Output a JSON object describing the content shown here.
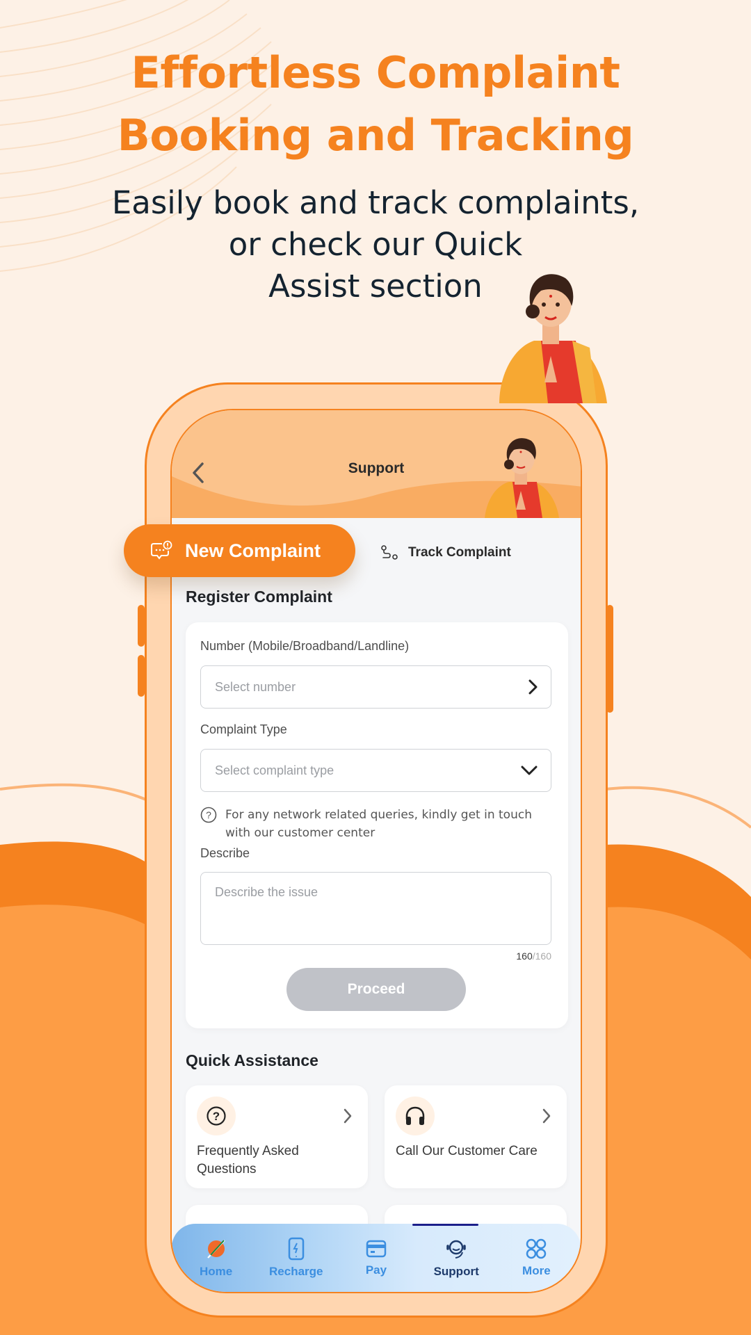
{
  "hero": {
    "title_line1": "Effortless Complaint",
    "title_line2": "Booking and Tracking",
    "subtitle_line1": "Easily book and track complaints,",
    "subtitle_line2": "or check our Quick",
    "subtitle_line3": "Assist section"
  },
  "colors": {
    "brand_orange": "#f5821f",
    "background": "#fdf1e6",
    "nav_active": "#1d3a6b",
    "nav_inactive": "#3b8ee0"
  },
  "header": {
    "title": "Support",
    "back_icon": "chevron-left-icon"
  },
  "tabs": {
    "new_complaint": {
      "label": "New Complaint",
      "icon": "chat-alert-icon",
      "active": true
    },
    "track_complaint": {
      "label": "Track Complaint",
      "icon": "route-icon",
      "active": false
    }
  },
  "register": {
    "title": "Register Complaint",
    "number_label": "Number (Mobile/Broadband/Landline)",
    "number_placeholder": "Select number",
    "type_label": "Complaint Type",
    "type_placeholder": "Select complaint type",
    "help_text": "For any network related queries, kindly get in touch with our customer center",
    "describe_label": "Describe",
    "describe_placeholder": "Describe the issue",
    "counter_current": "160",
    "counter_max": "/160",
    "proceed_label": "Proceed"
  },
  "quick_assistance": {
    "title": "Quick Assistance",
    "items": [
      {
        "label": "Frequently Asked Questions",
        "icon": "question-circle-icon"
      },
      {
        "label": "Call Our Customer Care",
        "icon": "headphones-icon"
      }
    ]
  },
  "bottom_nav": {
    "items": [
      {
        "label": "Home",
        "icon": "home-logo-icon",
        "active": false
      },
      {
        "label": "Recharge",
        "icon": "phone-bolt-icon",
        "active": false
      },
      {
        "label": "Pay",
        "icon": "card-icon",
        "active": false
      },
      {
        "label": "Support",
        "icon": "headset-icon",
        "active": true
      },
      {
        "label": "More",
        "icon": "grid-circles-icon",
        "active": false
      }
    ]
  }
}
